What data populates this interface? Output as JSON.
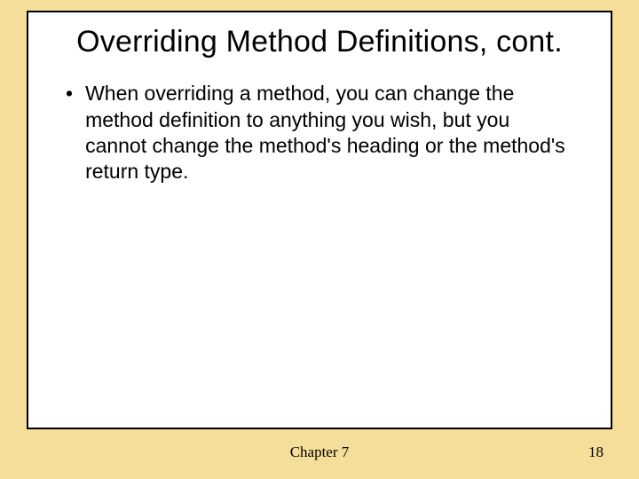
{
  "title": "Overriding Method Definitions, cont.",
  "bullets": {
    "item0": {
      "marker": "•",
      "text": "When overriding a method, you can change the method definition to anything you wish, but you cannot change the method's heading or the method's return type."
    }
  },
  "footer": {
    "center": "Chapter 7",
    "page": "18"
  }
}
